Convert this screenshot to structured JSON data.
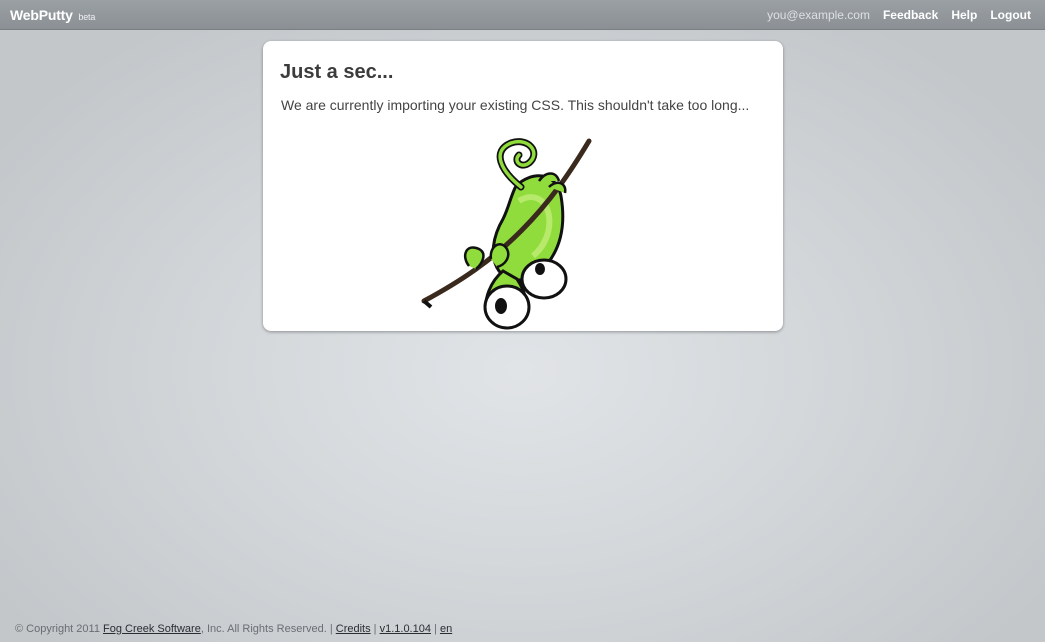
{
  "header": {
    "brand": "WebPutty",
    "brand_badge": "beta",
    "user_email": "you@example.com",
    "nav": {
      "feedback": "Feedback",
      "help": "Help",
      "logout": "Logout"
    }
  },
  "main": {
    "title": "Just a sec...",
    "message": "We are currently importing your existing CSS. This shouldn't take too long...",
    "illustration_icon": "chameleon-on-branch-icon"
  },
  "footer": {
    "copyright_prefix": "© Copyright 2011",
    "company_link": "Fog Creek Software",
    "rights_text": ", Inc. All Rights Reserved. |",
    "credits_link": "Credits",
    "sep1": "|",
    "version_link": "v1.1.0.104",
    "sep2": "|",
    "language_link": "en"
  },
  "colors": {
    "topbar": "#8b9095",
    "background": "#d4d8db",
    "mascot_green": "#8fdc3c",
    "card": "#ffffff"
  }
}
